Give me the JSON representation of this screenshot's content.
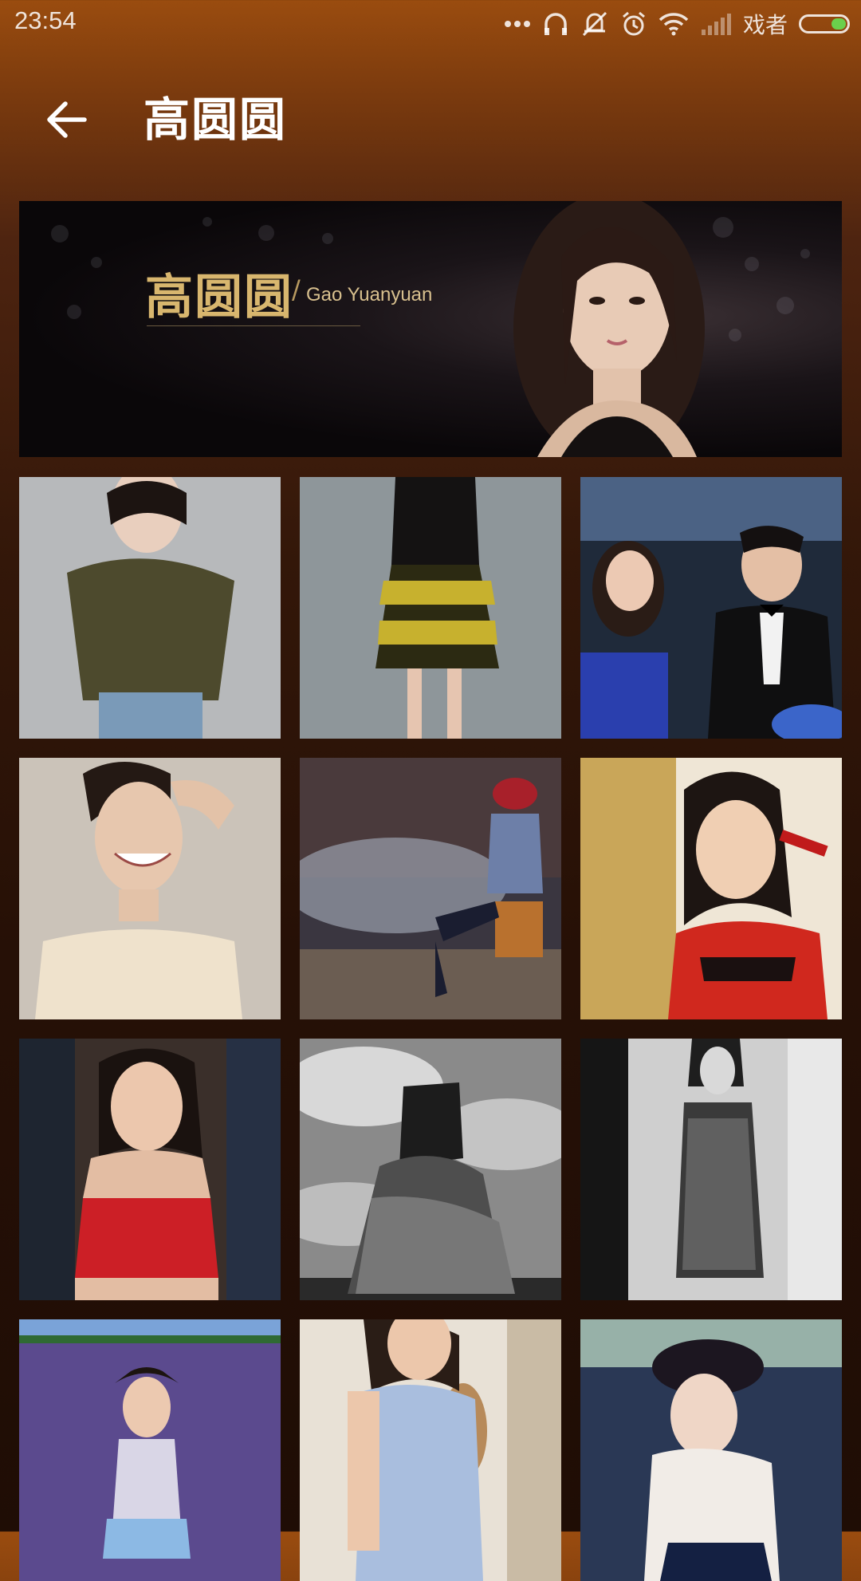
{
  "status_bar": {
    "time": "23:54",
    "carrier": "戏者",
    "icons": [
      "more-dots-icon",
      "headphones-icon",
      "mute-icon",
      "alarm-icon",
      "wifi-icon",
      "signal-icon",
      "battery-icon"
    ],
    "battery_color": "#6bd04c"
  },
  "app_bar": {
    "title": "高圆圆",
    "back_icon": "arrow-left-icon"
  },
  "banner": {
    "name_cn": "高圆圆",
    "separator": "/",
    "name_en": "Gao Yuanyuan"
  },
  "gallery": {
    "photos": [
      {
        "description": "portrait"
      },
      {
        "description": "portrait"
      },
      {
        "description": "portrait"
      },
      {
        "description": "portrait"
      },
      {
        "description": "portrait"
      },
      {
        "description": "portrait"
      },
      {
        "description": "portrait"
      },
      {
        "description": "portrait"
      },
      {
        "description": "portrait"
      },
      {
        "description": "portrait"
      },
      {
        "description": "portrait"
      },
      {
        "description": "portrait"
      }
    ]
  },
  "colors": {
    "header_brown": "#9a4c0f",
    "banner_gold": "#d8b66e"
  }
}
